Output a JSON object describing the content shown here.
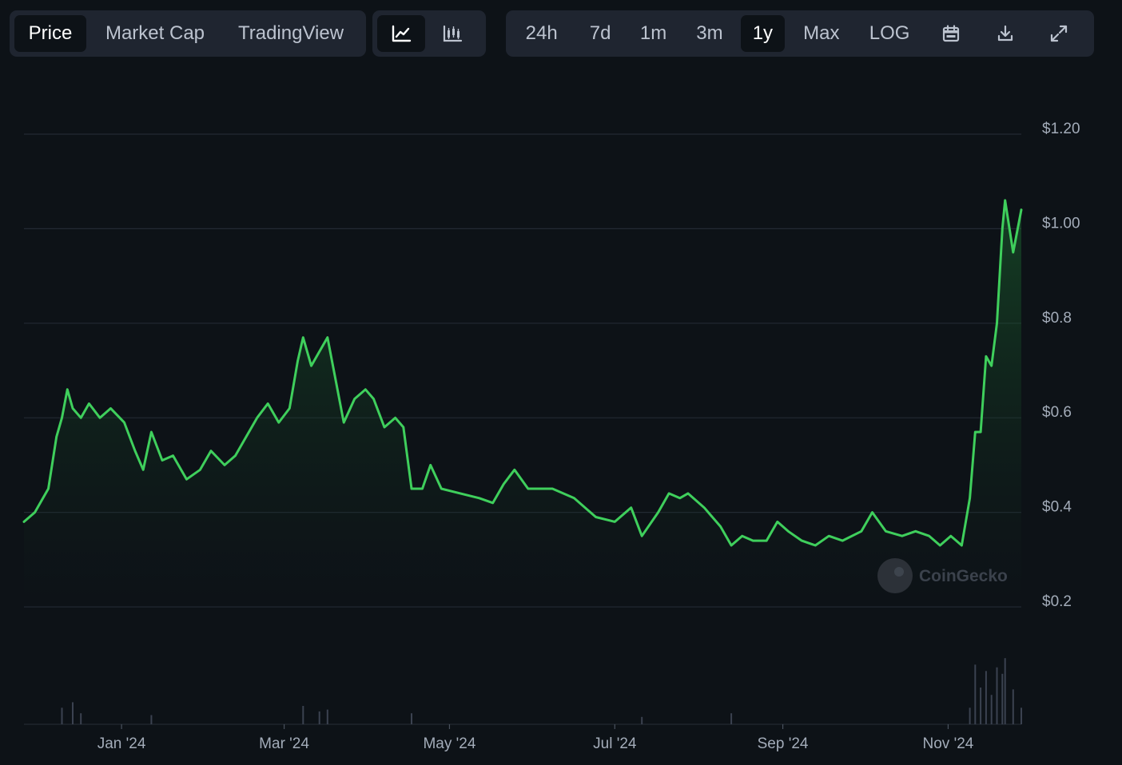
{
  "toolbar": {
    "data_tabs": [
      {
        "label": "Price",
        "active": true
      },
      {
        "label": "Market Cap",
        "active": false
      },
      {
        "label": "TradingView",
        "active": false
      }
    ],
    "chart_type_buttons": [
      {
        "icon": "line-chart-icon",
        "active": true
      },
      {
        "icon": "candlestick-chart-icon",
        "active": false
      }
    ],
    "ranges": [
      {
        "label": "24h",
        "active": false
      },
      {
        "label": "7d",
        "active": false
      },
      {
        "label": "1m",
        "active": false
      },
      {
        "label": "3m",
        "active": false
      },
      {
        "label": "1y",
        "active": true
      },
      {
        "label": "Max",
        "active": false
      },
      {
        "label": "LOG",
        "active": false
      }
    ],
    "tools": [
      "calendar-icon",
      "download-icon",
      "fullscreen-icon"
    ]
  },
  "watermark": "CoinGecko",
  "colors": {
    "background": "#0d1217",
    "toolbar_bg": "#1f2530",
    "line": "#3fcf5c",
    "grid": "#232a33",
    "volume": "#3b4250"
  },
  "chart_data": {
    "type": "area",
    "x_tick_labels": [
      "Jan '24",
      "Mar '24",
      "May '24",
      "Jul '24",
      "Sep '24",
      "Nov '24"
    ],
    "y_tick_labels": [
      "$1.20",
      "$1.00",
      "$0.8",
      "$0.6",
      "$0.4",
      "$0.2"
    ],
    "y_ticks": [
      1.2,
      1.0,
      0.8,
      0.6,
      0.4,
      0.2
    ],
    "ylim": [
      0.2,
      1.2
    ],
    "xlim": [
      "2023-11-26",
      "2024-11-28"
    ],
    "grid": true,
    "series": [
      {
        "values": [
          [
            "2023-11-26",
            0.38
          ],
          [
            "2023-11-30",
            0.4
          ],
          [
            "2023-12-05",
            0.45
          ],
          [
            "2023-12-08",
            0.56
          ],
          [
            "2023-12-10",
            0.6
          ],
          [
            "2023-12-12",
            0.66
          ],
          [
            "2023-12-14",
            0.62
          ],
          [
            "2023-12-17",
            0.6
          ],
          [
            "2023-12-20",
            0.63
          ],
          [
            "2023-12-24",
            0.6
          ],
          [
            "2023-12-28",
            0.62
          ],
          [
            "2024-01-02",
            0.59
          ],
          [
            "2024-01-06",
            0.53
          ],
          [
            "2024-01-09",
            0.49
          ],
          [
            "2024-01-12",
            0.57
          ],
          [
            "2024-01-16",
            0.51
          ],
          [
            "2024-01-20",
            0.52
          ],
          [
            "2024-01-25",
            0.47
          ],
          [
            "2024-01-30",
            0.49
          ],
          [
            "2024-02-03",
            0.53
          ],
          [
            "2024-02-08",
            0.5
          ],
          [
            "2024-02-12",
            0.52
          ],
          [
            "2024-02-16",
            0.56
          ],
          [
            "2024-02-20",
            0.6
          ],
          [
            "2024-02-24",
            0.63
          ],
          [
            "2024-02-28",
            0.59
          ],
          [
            "2024-03-03",
            0.62
          ],
          [
            "2024-03-06",
            0.72
          ],
          [
            "2024-03-08",
            0.77
          ],
          [
            "2024-03-11",
            0.71
          ],
          [
            "2024-03-14",
            0.74
          ],
          [
            "2024-03-17",
            0.77
          ],
          [
            "2024-03-20",
            0.68
          ],
          [
            "2024-03-23",
            0.59
          ],
          [
            "2024-03-27",
            0.64
          ],
          [
            "2024-03-31",
            0.66
          ],
          [
            "2024-04-03",
            0.64
          ],
          [
            "2024-04-07",
            0.58
          ],
          [
            "2024-04-11",
            0.6
          ],
          [
            "2024-04-14",
            0.58
          ],
          [
            "2024-04-17",
            0.45
          ],
          [
            "2024-04-21",
            0.45
          ],
          [
            "2024-04-24",
            0.5
          ],
          [
            "2024-04-28",
            0.45
          ],
          [
            "2024-05-05",
            0.44
          ],
          [
            "2024-05-12",
            0.43
          ],
          [
            "2024-05-17",
            0.42
          ],
          [
            "2024-05-21",
            0.46
          ],
          [
            "2024-05-25",
            0.49
          ],
          [
            "2024-05-30",
            0.45
          ],
          [
            "2024-06-08",
            0.45
          ],
          [
            "2024-06-16",
            0.43
          ],
          [
            "2024-06-24",
            0.39
          ],
          [
            "2024-07-01",
            0.38
          ],
          [
            "2024-07-07",
            0.41
          ],
          [
            "2024-07-11",
            0.35
          ],
          [
            "2024-07-17",
            0.4
          ],
          [
            "2024-07-21",
            0.44
          ],
          [
            "2024-07-25",
            0.43
          ],
          [
            "2024-07-28",
            0.44
          ],
          [
            "2024-08-03",
            0.41
          ],
          [
            "2024-08-09",
            0.37
          ],
          [
            "2024-08-13",
            0.33
          ],
          [
            "2024-08-17",
            0.35
          ],
          [
            "2024-08-21",
            0.34
          ],
          [
            "2024-08-26",
            0.34
          ],
          [
            "2024-08-30",
            0.38
          ],
          [
            "2024-09-03",
            0.36
          ],
          [
            "2024-09-08",
            0.34
          ],
          [
            "2024-09-13",
            0.33
          ],
          [
            "2024-09-18",
            0.35
          ],
          [
            "2024-09-23",
            0.34
          ],
          [
            "2024-09-30",
            0.36
          ],
          [
            "2024-10-04",
            0.4
          ],
          [
            "2024-10-09",
            0.36
          ],
          [
            "2024-10-15",
            0.35
          ],
          [
            "2024-10-20",
            0.36
          ],
          [
            "2024-10-25",
            0.35
          ],
          [
            "2024-10-29",
            0.33
          ],
          [
            "2024-11-02",
            0.35
          ],
          [
            "2024-11-06",
            0.33
          ],
          [
            "2024-11-09",
            0.43
          ],
          [
            "2024-11-11",
            0.57
          ],
          [
            "2024-11-13",
            0.57
          ],
          [
            "2024-11-15",
            0.73
          ],
          [
            "2024-11-17",
            0.71
          ],
          [
            "2024-11-19",
            0.8
          ],
          [
            "2024-11-21",
            1.0
          ],
          [
            "2024-11-22",
            1.06
          ],
          [
            "2024-11-25",
            0.95
          ],
          [
            "2024-11-28",
            1.04
          ]
        ]
      }
    ],
    "volume": [
      [
        "2023-12-10",
        0.18
      ],
      [
        "2023-12-14",
        0.24
      ],
      [
        "2023-12-17",
        0.12
      ],
      [
        "2024-01-12",
        0.1
      ],
      [
        "2024-03-08",
        0.2
      ],
      [
        "2024-03-14",
        0.14
      ],
      [
        "2024-03-17",
        0.16
      ],
      [
        "2024-04-17",
        0.12
      ],
      [
        "2024-07-11",
        0.08
      ],
      [
        "2024-08-13",
        0.12
      ],
      [
        "2024-11-09",
        0.18
      ],
      [
        "2024-11-11",
        0.65
      ],
      [
        "2024-11-13",
        0.4
      ],
      [
        "2024-11-15",
        0.58
      ],
      [
        "2024-11-17",
        0.32
      ],
      [
        "2024-11-19",
        0.62
      ],
      [
        "2024-11-21",
        0.55
      ],
      [
        "2024-11-22",
        0.72
      ],
      [
        "2024-11-25",
        0.38
      ],
      [
        "2024-11-28",
        0.18
      ]
    ]
  }
}
